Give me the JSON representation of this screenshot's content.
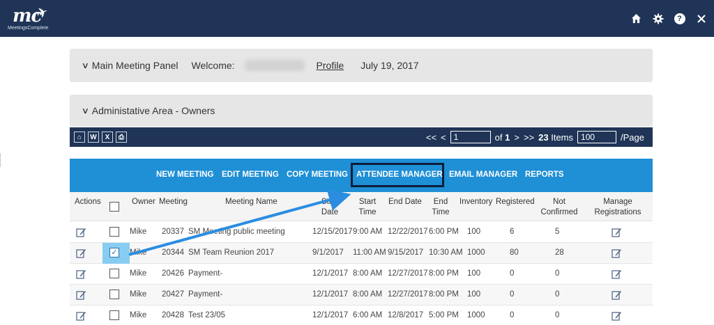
{
  "header": {
    "logo_mark": "mc",
    "logo_text": "MeetingsComplete",
    "icons": [
      "home-icon",
      "gear-icon",
      "help-icon",
      "close-icon"
    ],
    "help_glyph": "?"
  },
  "panel_main": {
    "title": "Main Meeting Panel",
    "welcome_label": "Welcome:",
    "profile_link": "Profile",
    "date": "July 19, 2017"
  },
  "panel_admin": {
    "title": "Administative Area - Owners"
  },
  "export_icons": [
    "pdf-icon",
    "word-icon",
    "excel-icon",
    "print-icon"
  ],
  "export_glyphs": [
    "⌂",
    "W",
    "X",
    "⎙"
  ],
  "pager": {
    "first": "<<",
    "prev": "<",
    "page_value": "1",
    "of_label": "of",
    "page_count": "1",
    "next": ">",
    "last": ">>",
    "items_count": "23",
    "items_label": "Items",
    "per_page_value": "100",
    "per_page_label": "/Page"
  },
  "actions": [
    "NEW MEETING",
    "EDIT MEETING",
    "COPY MEETING",
    "ATTENDEE MANAGER",
    "EMAIL MANAGER",
    "REPORTS"
  ],
  "table": {
    "columns": {
      "actions": "Actions",
      "owner": "Owner",
      "meeting": "Meeting",
      "meeting_name": "Meeting Name",
      "start_date_1": "Start",
      "start_date_2": "Date",
      "start_time_1": "Start",
      "start_time_2": "Time",
      "end_date": "End Date",
      "end_time_1": "End",
      "end_time_2": "Time",
      "inventory": "Inventory",
      "registered": "Registered",
      "not_confirmed_1": "Not",
      "not_confirmed_2": "Confirmed",
      "manage_1": "Manage",
      "manage_2": "Registrations"
    },
    "rows": [
      {
        "owner": "Mike",
        "meeting": "20337",
        "name": "SM Meeting public meeting",
        "start_date": "12/15/2017",
        "start_time": "9:00 AM",
        "end_date": "12/22/2017",
        "end_time": "6:00 PM",
        "inventory": "100",
        "registered": "6",
        "not_confirmed": "5",
        "checked": false
      },
      {
        "owner": "Mike",
        "meeting": "20344",
        "name": "SM Team Reunion 2017",
        "start_date": "9/1/2017",
        "start_time": "11:00 AM",
        "end_date": "9/15/2017",
        "end_time": "10:30 AM",
        "inventory": "1000",
        "registered": "80",
        "not_confirmed": "28",
        "checked": true
      },
      {
        "owner": "Mike",
        "meeting": "20426",
        "name": "Payment-",
        "start_date": "12/1/2017",
        "start_time": "8:00 AM",
        "end_date": "12/27/2017",
        "end_time": "8:00 PM",
        "inventory": "100",
        "registered": "0",
        "not_confirmed": "0",
        "checked": false
      },
      {
        "owner": "Mike",
        "meeting": "20427",
        "name": "Payment-",
        "start_date": "12/1/2017",
        "start_time": "8:00 AM",
        "end_date": "12/27/2017",
        "end_time": "8:00 PM",
        "inventory": "100",
        "registered": "0",
        "not_confirmed": "0",
        "checked": false
      },
      {
        "owner": "Mike",
        "meeting": "20428",
        "name": "Test 23/05",
        "start_date": "12/1/2017",
        "start_time": "6:00 AM",
        "end_date": "12/8/2017",
        "end_time": "5:00 PM",
        "inventory": "1000",
        "registered": "0",
        "not_confirmed": "0",
        "checked": false
      }
    ]
  },
  "colors": {
    "nav_bg": "#1f3456",
    "action_bar": "#1f8fd6",
    "highlight_box": "#0c1e3a",
    "annotation_arrow": "#2b8de0",
    "checkbox_highlight": "#87cdf1"
  }
}
